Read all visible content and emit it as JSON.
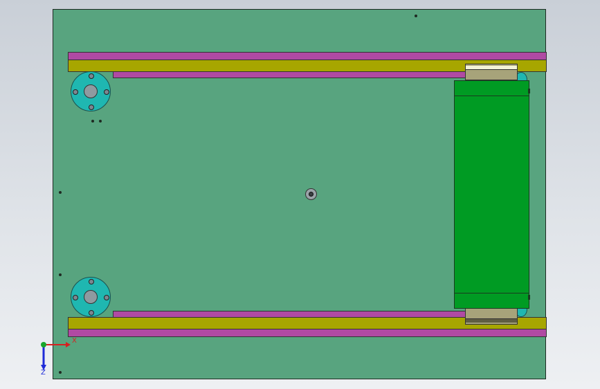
{
  "viewport": {
    "background": [
      "#c9cfd7",
      "#eef0f3"
    ],
    "model": {
      "base_plate_color": "#58a47f",
      "rail_outer_color": "#b04aa3",
      "rail_mid_color": "#a7a600",
      "flange_color": "#1fb7b1",
      "block_color": "#009b23",
      "cap_color": "#a7a37a"
    }
  },
  "triad": {
    "x_label": "X",
    "y_label": "Y",
    "z_label": "Z",
    "x_color": "#d62020",
    "y_color": "#1aa52a",
    "z_color": "#1f2bd8"
  }
}
